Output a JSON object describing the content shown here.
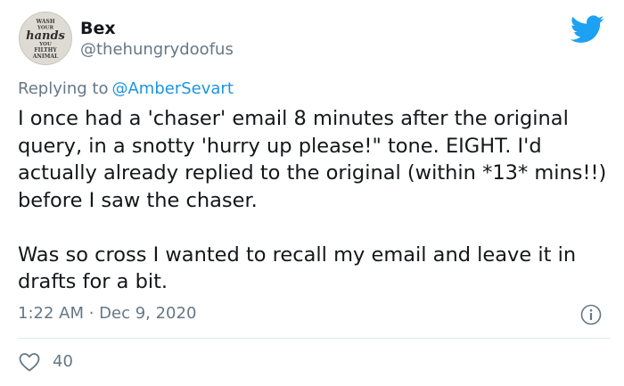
{
  "tweet": {
    "author": {
      "display_name": "Bex",
      "handle": "@thehungrydoofus",
      "avatar_lines": [
        "WASH",
        "YOUR",
        "hands",
        "YOU",
        "FILTHY",
        "ANIMAL"
      ]
    },
    "reply": {
      "label": "Replying to",
      "mention": "@AmberSevart"
    },
    "body": "I once had a 'chaser' email 8 minutes after the original query, in a snotty 'hurry up please!\" tone. EIGHT. I'd actually already replied to the original (within *13* mins!!) before I saw the chaser.\n\nWas so cross I wanted to recall my email and leave it in drafts for a bit.",
    "timestamp": "1:22 AM · Dec 9, 2020",
    "likes": "40"
  },
  "icons": {
    "brand": "twitter-bird-icon",
    "info": "info-icon",
    "like": "heart-icon"
  },
  "colors": {
    "brand_blue": "#1da1f2",
    "mention_blue": "#1b95e0",
    "secondary_text": "#657786",
    "primary_text": "#14171a",
    "divider": "#e1e8ed"
  }
}
